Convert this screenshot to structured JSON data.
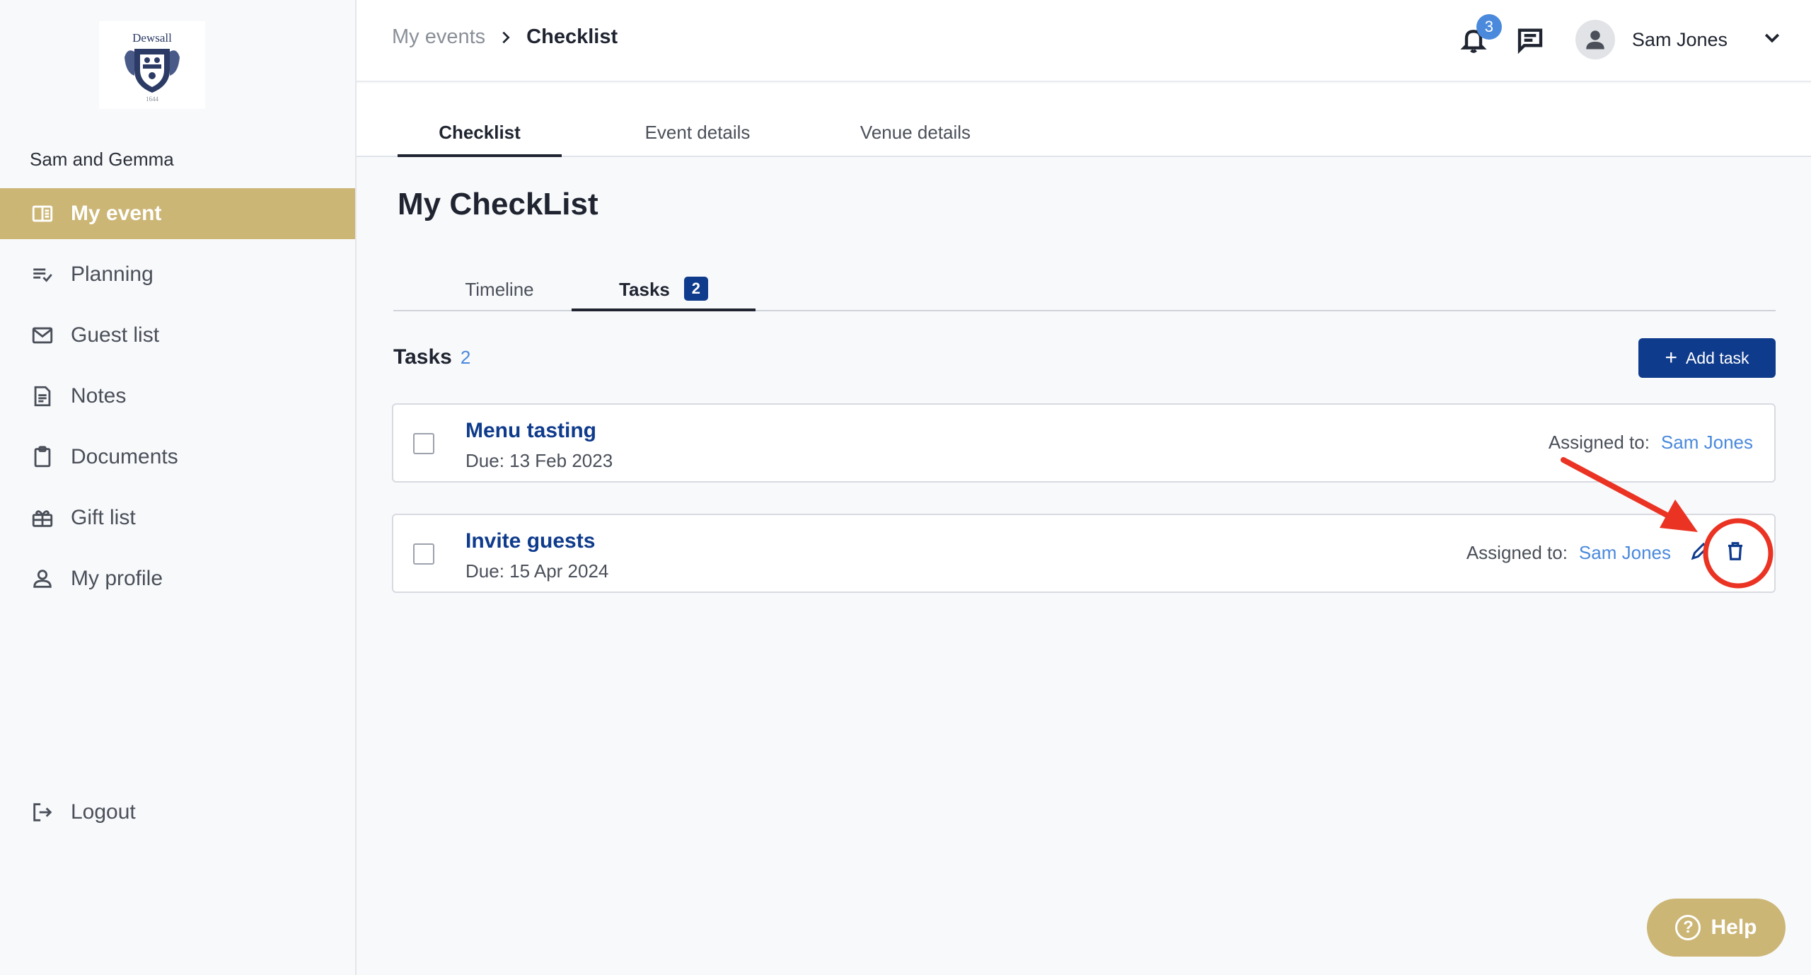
{
  "brand": {
    "logo_text": "Dewsall",
    "logo_year": "1644",
    "accent": "#ccb676",
    "primary": "#0f3b8c",
    "link": "#4a89dc"
  },
  "sidebar": {
    "event_name": "Sam and Gemma",
    "items": [
      {
        "label": "My event",
        "icon": "book-open-icon",
        "active": true
      },
      {
        "label": "Planning",
        "icon": "checklist-icon"
      },
      {
        "label": "Guest list",
        "icon": "mail-icon"
      },
      {
        "label": "Notes",
        "icon": "note-icon"
      },
      {
        "label": "Documents",
        "icon": "clipboard-icon"
      },
      {
        "label": "Gift list",
        "icon": "gift-icon"
      },
      {
        "label": "My profile",
        "icon": "person-icon"
      }
    ],
    "logout_label": "Logout"
  },
  "header": {
    "breadcrumb": {
      "parent": "My events",
      "current": "Checklist"
    },
    "notification_count": "3",
    "user_name": "Sam Jones"
  },
  "main_tabs": [
    {
      "label": "Checklist",
      "active": true
    },
    {
      "label": "Event details"
    },
    {
      "label": "Venue details"
    }
  ],
  "page": {
    "title": "My CheckList",
    "sub_tabs": [
      {
        "label": "Timeline"
      },
      {
        "label": "Tasks",
        "count": "2",
        "active": true
      }
    ],
    "tasks_heading": "Tasks",
    "tasks_count": "2",
    "add_task_label": "Add task"
  },
  "tasks": [
    {
      "title": "Menu tasting",
      "due": "Due: 13 Feb 2023",
      "assigned_label": "Assigned to:",
      "assignee": "Sam Jones"
    },
    {
      "title": "Invite guests",
      "due": "Due: 15 Apr 2024",
      "assigned_label": "Assigned to:",
      "assignee": "Sam Jones"
    }
  ],
  "help_label": "Help"
}
